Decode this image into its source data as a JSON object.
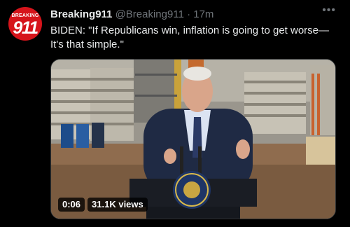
{
  "account": {
    "avatar_top_text": "BREAKING",
    "avatar_number": "911",
    "display_name": "Breaking911",
    "handle": "@Breaking911",
    "separator": "·",
    "time": "17m",
    "more_label": "•••"
  },
  "tweet": {
    "text": "BIDEN: \"If Republicans win, inflation is going to get worse—\nIt's that simple.\""
  },
  "video": {
    "duration": "0:06",
    "views": "31.1K views"
  },
  "colors": {
    "brand_red": "#d6141b",
    "background": "#000000",
    "muted": "#71767b"
  }
}
